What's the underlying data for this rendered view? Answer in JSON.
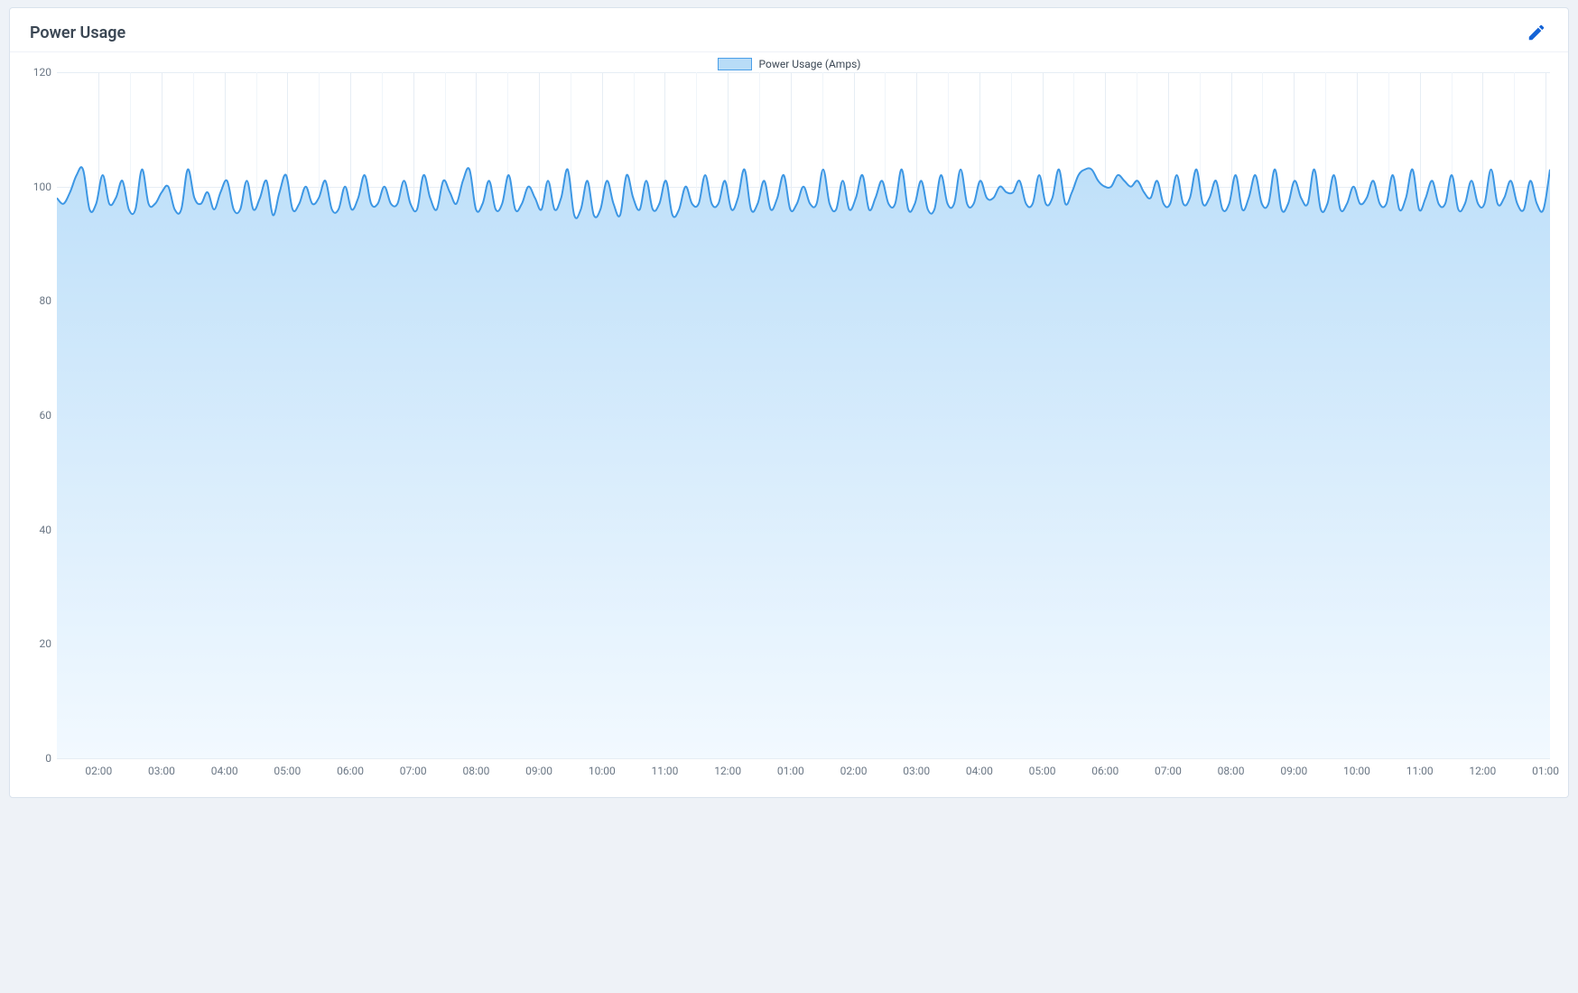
{
  "card": {
    "title": "Power Usage",
    "edit_icon": "pencil-icon"
  },
  "legend": {
    "label": "Power Usage (Amps)"
  },
  "chart_data": {
    "type": "area",
    "title": "Power Usage",
    "xlabel": "",
    "ylabel": "",
    "ylim": [
      0,
      120
    ],
    "yticks": [
      0,
      20,
      40,
      60,
      80,
      100,
      120
    ],
    "x_tick_labels": [
      "02:00",
      "03:00",
      "04:00",
      "05:00",
      "06:00",
      "07:00",
      "08:00",
      "09:00",
      "10:00",
      "11:00",
      "12:00",
      "01:00",
      "02:00",
      "03:00",
      "04:00",
      "05:00",
      "06:00",
      "07:00",
      "08:00",
      "09:00",
      "10:00",
      "11:00",
      "12:00",
      "01:00"
    ],
    "series": [
      {
        "name": "Power Usage (Amps)",
        "stroke": "#3d97e4",
        "fill_top": "#bfe0f9",
        "fill_bottom": "#f2f9ff",
        "values": [
          98,
          97,
          99,
          102,
          103,
          96,
          97,
          102,
          97,
          98,
          101,
          96,
          96,
          103,
          97,
          97,
          99,
          100,
          96,
          96,
          103,
          98,
          97,
          99,
          96,
          99,
          101,
          96,
          96,
          101,
          96,
          98,
          101,
          95,
          99,
          102,
          96,
          97,
          100,
          97,
          98,
          101,
          96,
          96,
          100,
          96,
          98,
          102,
          97,
          97,
          100,
          97,
          97,
          101,
          97,
          96,
          102,
          98,
          96,
          101,
          99,
          97,
          101,
          103,
          96,
          97,
          101,
          96,
          97,
          102,
          96,
          97,
          100,
          98,
          96,
          101,
          96,
          98,
          103,
          95,
          96,
          101,
          95,
          96,
          101,
          97,
          95,
          102,
          98,
          96,
          101,
          96,
          97,
          101,
          95,
          96,
          100,
          97,
          97,
          102,
          97,
          97,
          101,
          96,
          98,
          103,
          96,
          97,
          101,
          96,
          98,
          102,
          96,
          97,
          100,
          97,
          97,
          103,
          97,
          96,
          101,
          96,
          98,
          102,
          96,
          98,
          101,
          97,
          97,
          103,
          96,
          97,
          101,
          96,
          96,
          102,
          97,
          97,
          103,
          97,
          97,
          101,
          98,
          98,
          100,
          99,
          99,
          101,
          97,
          97,
          102,
          97,
          98,
          103,
          97,
          99,
          102,
          103,
          103,
          101,
          100,
          100,
          102,
          101,
          100,
          101,
          99,
          98,
          101,
          97,
          97,
          102,
          97,
          98,
          103,
          97,
          98,
          101,
          96,
          97,
          102,
          96,
          98,
          102,
          97,
          97,
          103,
          96,
          97,
          101,
          98,
          97,
          103,
          96,
          97,
          102,
          96,
          97,
          100,
          97,
          98,
          101,
          97,
          97,
          102,
          96,
          98,
          103,
          96,
          98,
          101,
          97,
          97,
          102,
          96,
          97,
          101,
          97,
          97,
          103,
          97,
          98,
          101,
          97,
          96,
          101,
          97,
          96,
          103
        ]
      }
    ]
  }
}
